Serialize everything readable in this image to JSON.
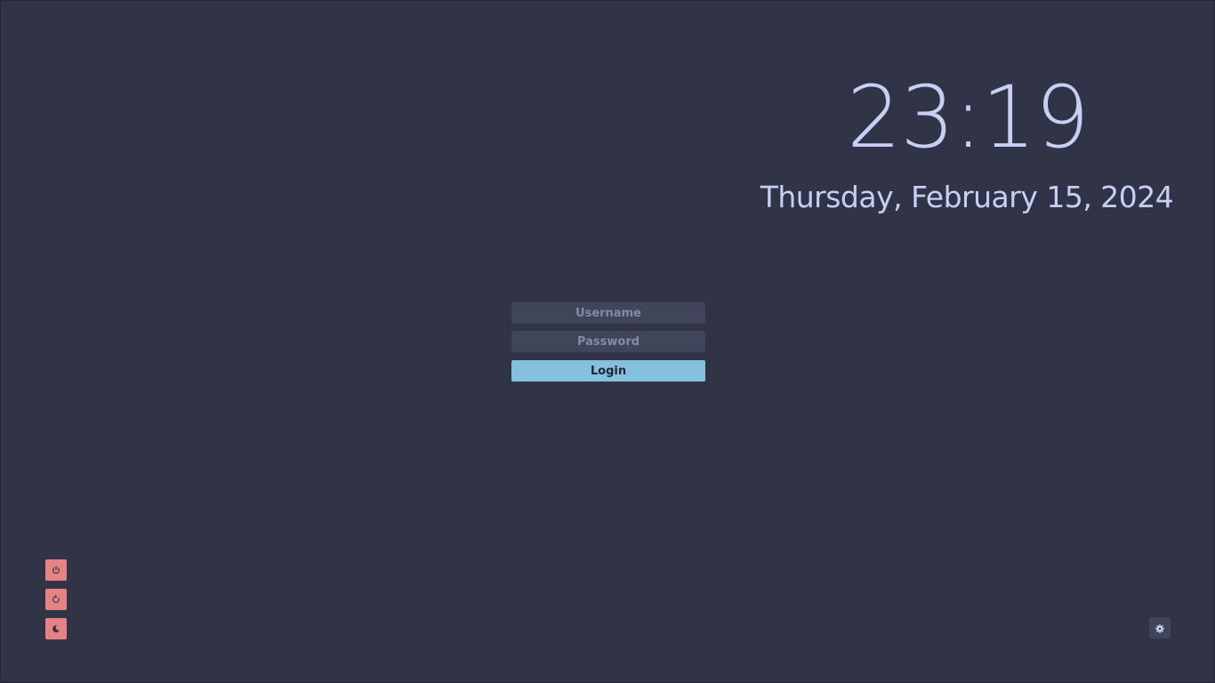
{
  "clock": {
    "time": "23:19",
    "date": "Thursday, February 15, 2024"
  },
  "login": {
    "username_placeholder": "Username",
    "username_value": "",
    "password_placeholder": "Password",
    "password_value": "",
    "login_label": "Login"
  },
  "power_buttons": [
    {
      "icon": "power-icon",
      "action": "shutdown"
    },
    {
      "icon": "restart-icon",
      "action": "reboot"
    },
    {
      "icon": "moon-icon",
      "action": "suspend"
    }
  ],
  "settings": {
    "icon": "gear-icon"
  },
  "colors": {
    "background": "#303446",
    "text": "#c6d0f5",
    "field_bg": "#414559",
    "placeholder": "#838ba7",
    "accent": "#85c1dc",
    "danger": "#e78284"
  }
}
